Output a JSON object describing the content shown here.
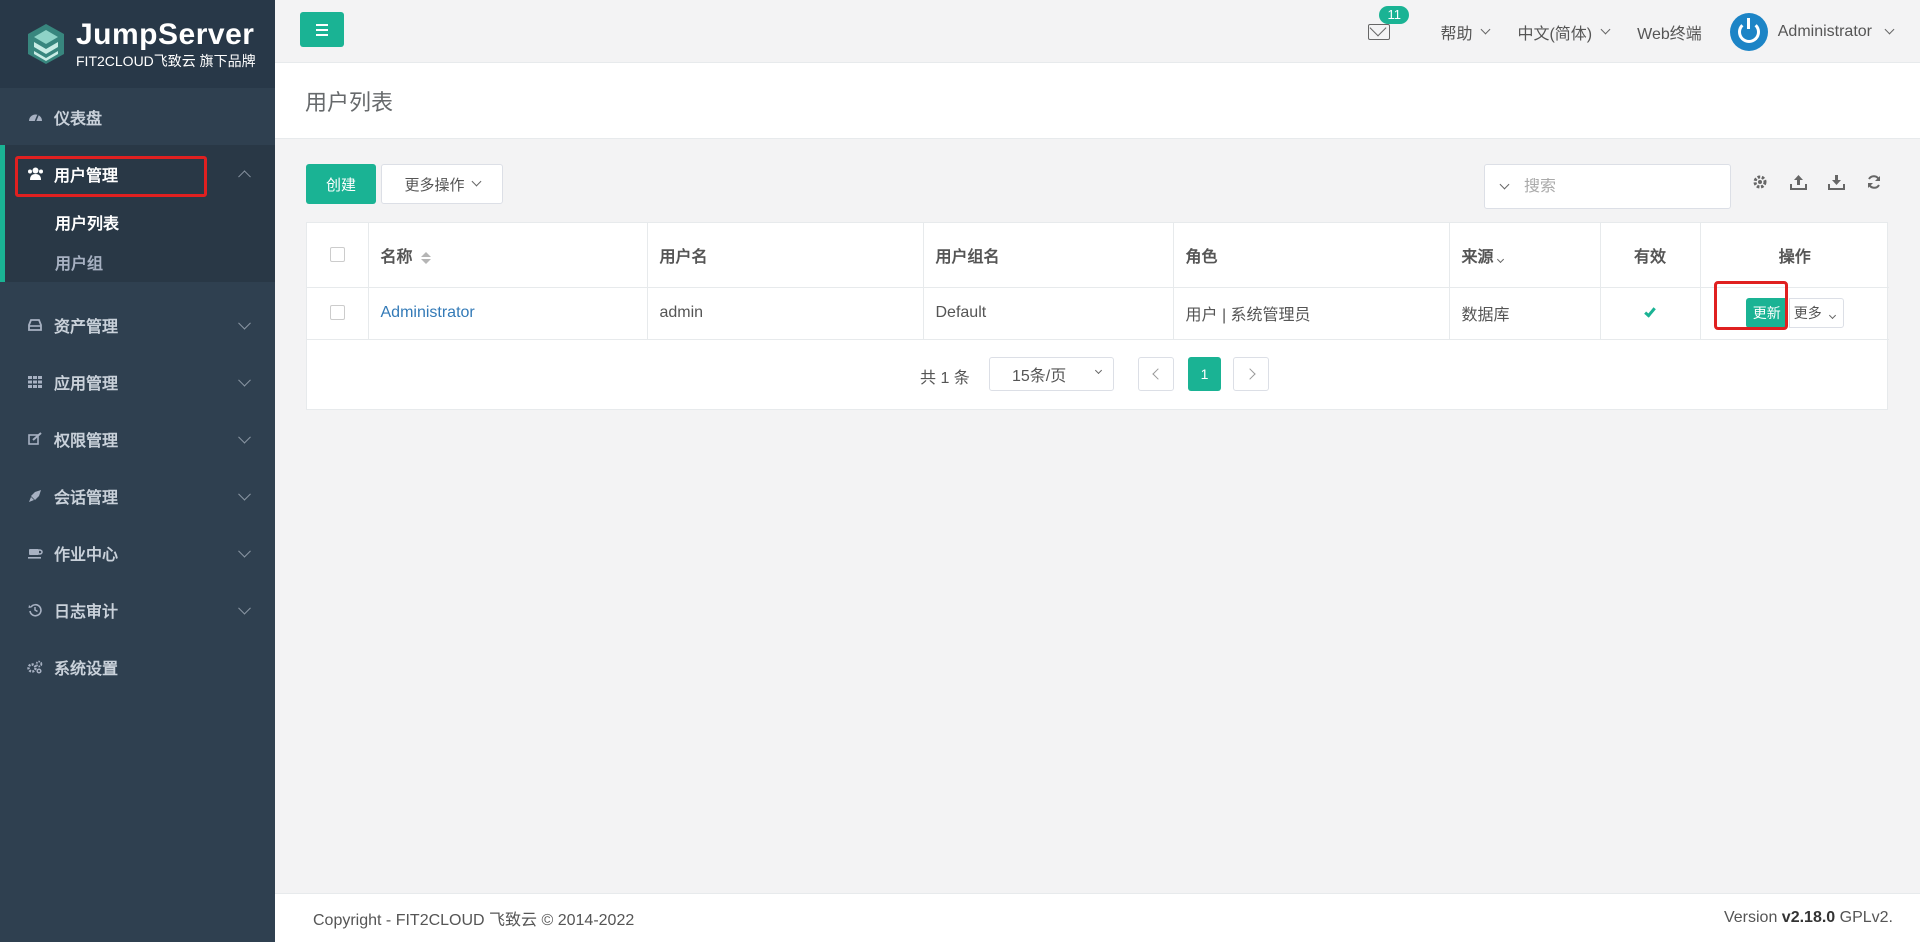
{
  "brand": {
    "title": "JumpServer",
    "subtitle": "FIT2CLOUD飞致云 旗下品牌"
  },
  "sidebar": {
    "items": [
      {
        "label": "仪表盘",
        "icon": "dashboard-icon"
      },
      {
        "label": "用户管理",
        "icon": "users-icon",
        "expanded": true,
        "children": [
          {
            "label": "用户列表",
            "active": true
          },
          {
            "label": "用户组"
          }
        ]
      },
      {
        "label": "资产管理",
        "icon": "inbox-icon"
      },
      {
        "label": "应用管理",
        "icon": "grid-icon"
      },
      {
        "label": "权限管理",
        "icon": "edit-icon"
      },
      {
        "label": "会话管理",
        "icon": "rocket-icon"
      },
      {
        "label": "作业中心",
        "icon": "coffee-icon"
      },
      {
        "label": "日志审计",
        "icon": "history-icon"
      },
      {
        "label": "系统设置",
        "icon": "gears-icon"
      }
    ]
  },
  "topbar": {
    "mail_badge": "11",
    "help": "帮助",
    "language": "中文(简体)",
    "web_terminal": "Web终端",
    "user": "Administrator"
  },
  "page": {
    "title": "用户列表"
  },
  "toolbar": {
    "create": "创建",
    "more_actions": "更多操作",
    "search_placeholder": "搜索"
  },
  "table": {
    "headers": {
      "name": "名称",
      "username": "用户名",
      "group": "用户组名",
      "role": "角色",
      "source": "来源",
      "valid": "有效",
      "actions": "操作"
    },
    "rows": [
      {
        "name": "Administrator",
        "username": "admin",
        "group": "Default",
        "role": "用户 | 系统管理员",
        "source": "数据库",
        "valid": true,
        "update": "更新",
        "more": "更多"
      }
    ]
  },
  "pagination": {
    "total": "共 1 条",
    "page_size": "15条/页",
    "current": "1"
  },
  "footer": {
    "copyright": "Copyright - FIT2CLOUD 飞致云 © 2014-2022",
    "version_prefix": "Version",
    "version": "v2.18.0",
    "license": "GPLv2."
  },
  "colors": {
    "accent": "#1ab394",
    "sidebar": "#2f4050",
    "link": "#337ab7",
    "highlight": "#e02020"
  }
}
